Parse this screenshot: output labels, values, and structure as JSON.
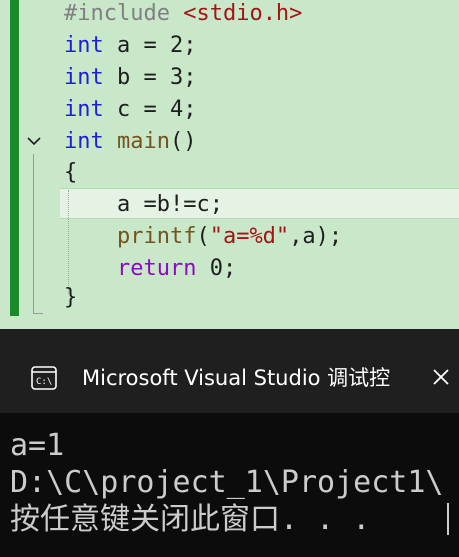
{
  "editor": {
    "lines": [
      {
        "type": "include",
        "directive": "#include ",
        "header": "<stdio.h>"
      },
      {
        "type": "decl",
        "kw": "int",
        "rest": " a = 2;"
      },
      {
        "type": "decl",
        "kw": "int",
        "rest": " b = 3;"
      },
      {
        "type": "decl",
        "kw": "int",
        "rest": " c = 4;"
      },
      {
        "type": "func",
        "kw": "int",
        "name": " main",
        "rest": "()"
      },
      {
        "type": "plain",
        "text": "{"
      },
      {
        "type": "plain",
        "text": "    a =b!=c;"
      },
      {
        "type": "printf",
        "fn": "    printf",
        "open": "(",
        "str": "\"a=%d\"",
        "rest": ",a);"
      },
      {
        "type": "return",
        "kw": "    return",
        "rest": " 0;"
      },
      {
        "type": "plain",
        "text": "}"
      }
    ],
    "fold_icon": "chevron-down-icon"
  },
  "console": {
    "title": "Microsoft Visual Studio 调试控",
    "app_icon": "console-app-icon",
    "close_icon": "close-icon",
    "output": [
      "a=1",
      "D:\\C\\project_1\\Project1\\",
      "按任意键关闭此窗口. . ."
    ]
  }
}
